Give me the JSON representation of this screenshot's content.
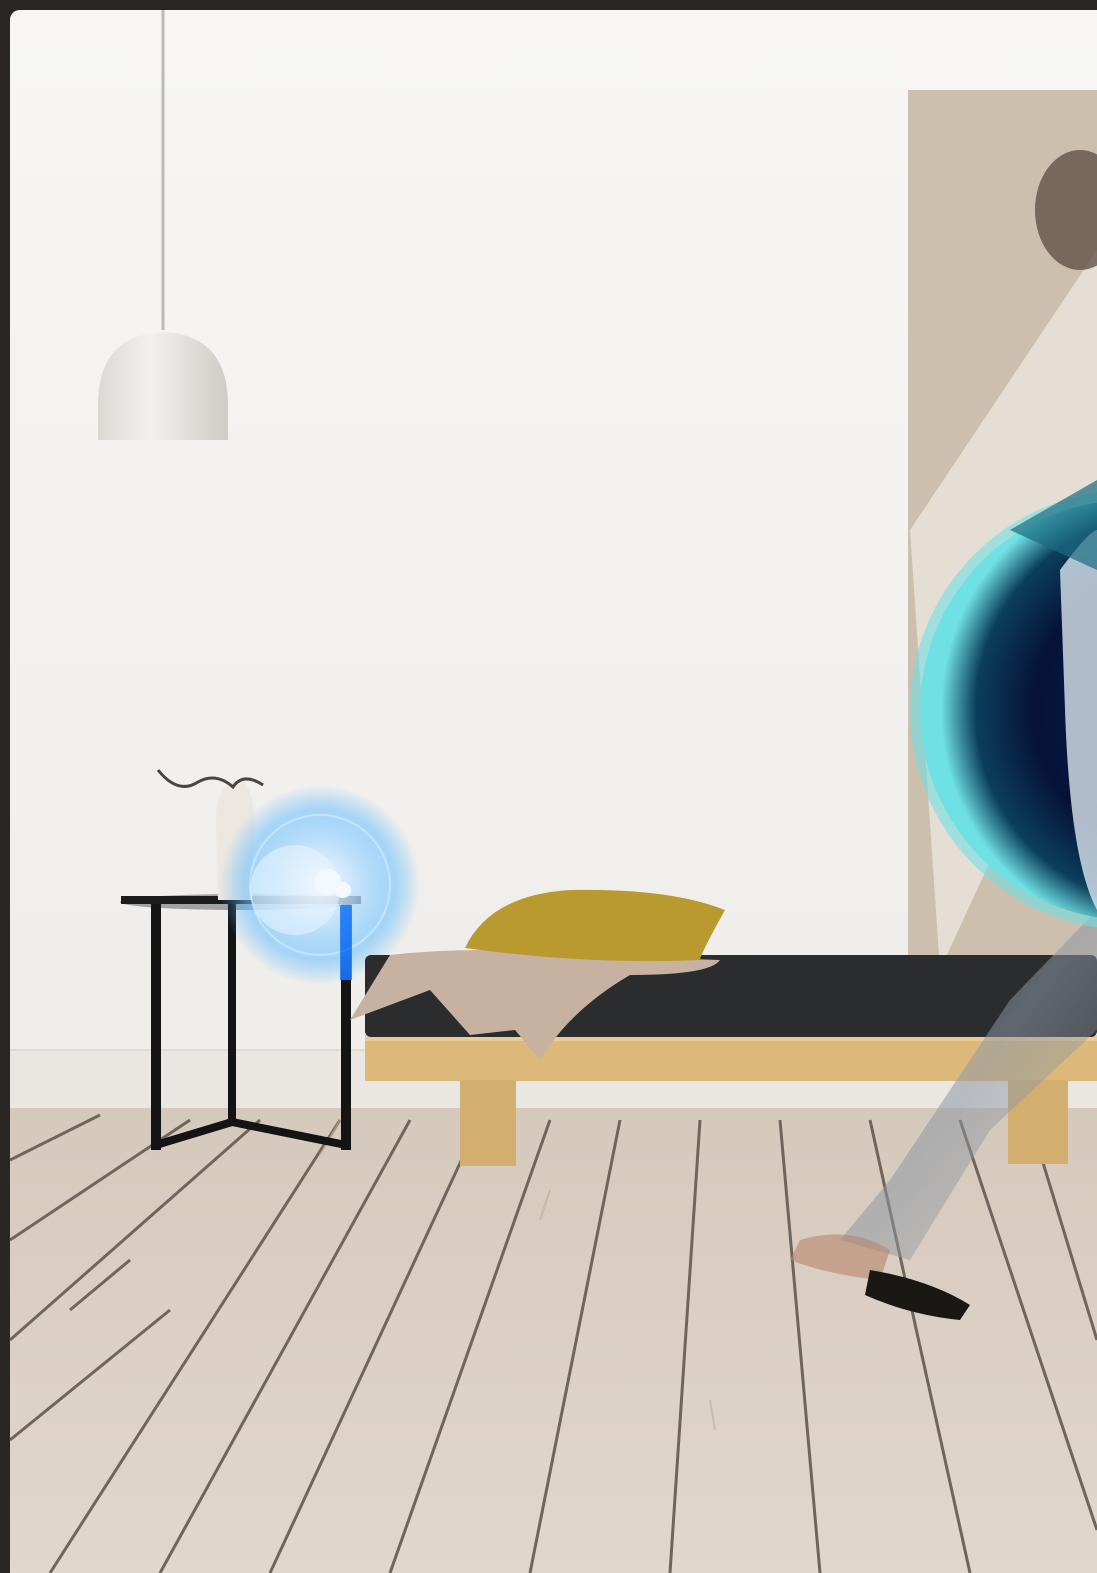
{
  "scene": {
    "colors": {
      "frame_dark": "#2a2624",
      "wall": "#f4f3f1",
      "floor": "#d8ccbf",
      "wood": "#d9b77a",
      "mattress": "#2b2c2e",
      "pillow": "#b89a2e",
      "throw": "#c7b1a0",
      "lamp": "#e6e4e1",
      "panel": "#cdbfae",
      "sensor_glow": "#4fb4ff",
      "disc_outer": "#6fe0e3",
      "disc_mid": "#0c3b5a",
      "disc_inner": "#061238"
    },
    "icons": [
      "motion-sensor-icon",
      "radar-waves-icon"
    ]
  }
}
